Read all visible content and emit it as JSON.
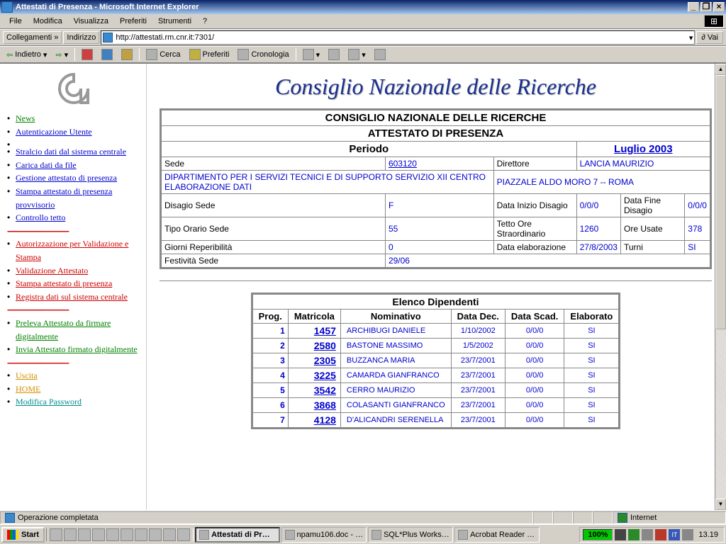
{
  "window": {
    "title": "Attestati di Presenza - Microsoft Internet Explorer",
    "menu": [
      "File",
      "Modifica",
      "Visualizza",
      "Preferiti",
      "Strumenti",
      "?"
    ],
    "links_label": "Collegamenti",
    "addr_label": "Indirizzo",
    "url": "http://attestati.rm.cnr.it:7301/",
    "go": "Vai",
    "back": "Indietro",
    "search": "Cerca",
    "fav": "Preferiti",
    "hist": "Cronologia"
  },
  "sidebar": {
    "items": [
      {
        "label": "News",
        "cls": "green"
      },
      {
        "label": "Autenticazione Utente",
        "cls": "blue"
      },
      {
        "spacer": true
      },
      {
        "label": "Stralcio dati dal sistema centrale",
        "cls": "blue"
      },
      {
        "label": "Carica dati da file",
        "cls": "blue"
      },
      {
        "label": "Gestione attestato di presenza",
        "cls": "blue"
      },
      {
        "label": "Stampa attestato di presenza provvisorio",
        "cls": "blue"
      },
      {
        "label": "Controllo tetto",
        "cls": "blue"
      },
      {
        "divider": true
      },
      {
        "label": "Autorizzazione per Validazione e Stampa",
        "cls": "red"
      },
      {
        "label": "Validazione Attestato",
        "cls": "red"
      },
      {
        "label": "Stampa attestato di presenza",
        "cls": "red"
      },
      {
        "label": "Registra dati sul sistema centrale",
        "cls": "red"
      },
      {
        "divider": true
      },
      {
        "label": "Preleva Attestato da firmare digitalmente",
        "cls": "green"
      },
      {
        "label": "Invia Attestato firmato digitalmente",
        "cls": "green"
      },
      {
        "divider": true
      },
      {
        "label": "Uscita",
        "cls": "orange"
      },
      {
        "label": "HOME",
        "cls": "orange"
      },
      {
        "label": "Modifica Password",
        "cls": "teal"
      }
    ]
  },
  "brand": "Consiglio Nazionale delle Ricerche",
  "header": {
    "l1": "CONSIGLIO NAZIONALE DELLE RICERCHE",
    "l2": "ATTESTATO DI PRESENZA",
    "periodo_lbl": "Periodo",
    "periodo_val": "Luglio 2003",
    "rows": [
      [
        "Sede",
        "603120",
        "Direttore",
        "LANCIA MAURIZIO"
      ],
      [
        "DIPARTIMENTO PER I SERVIZI TECNICI E DI SUPPORTO SERVIZIO XII CENTRO ELABORAZIONE DATI",
        "PIAZZALE ALDO MORO 7 -- ROMA"
      ],
      [
        "Disagio Sede",
        "F",
        "Data Inizio Disagio",
        "0/0/0",
        "Data Fine Disagio",
        "0/0/0"
      ],
      [
        "Tipo Orario Sede",
        "55",
        "Tetto Ore Straordinario",
        "1260",
        "Ore Usate",
        "378"
      ],
      [
        "Giorni Reperibilità",
        "0",
        "Data elaborazione",
        "27/8/2003",
        "Turni",
        "SI"
      ],
      [
        "Festività Sede",
        "29/06"
      ]
    ]
  },
  "emp": {
    "caption": "Elenco Dipendenti",
    "cols": [
      "Prog.",
      "Matricola",
      "Nominativo",
      "Data Dec.",
      "Data Scad.",
      "Elaborato"
    ],
    "rows": [
      [
        "1",
        "1457",
        "ARCHIBUGI DANIELE",
        "1/10/2002",
        "0/0/0",
        "SI"
      ],
      [
        "2",
        "2580",
        "BASTONE MASSIMO",
        "1/5/2002",
        "0/0/0",
        "SI"
      ],
      [
        "3",
        "2305",
        "BUZZANCA MARIA",
        "23/7/2001",
        "0/0/0",
        "SI"
      ],
      [
        "4",
        "3225",
        "CAMARDA GIANFRANCO",
        "23/7/2001",
        "0/0/0",
        "SI"
      ],
      [
        "5",
        "3542",
        "CERRO MAURIZIO",
        "23/7/2001",
        "0/0/0",
        "SI"
      ],
      [
        "6",
        "3868",
        "COLASANTI GIANFRANCO",
        "23/7/2001",
        "0/0/0",
        "SI"
      ],
      [
        "7",
        "4128",
        "D'ALICANDRI SERENELLA",
        "23/7/2001",
        "0/0/0",
        "SI"
      ]
    ]
  },
  "status": {
    "msg": "Operazione completata",
    "zone": "Internet"
  },
  "taskbar": {
    "start": "Start",
    "tasks": [
      {
        "label": "Attestati di Pr…",
        "active": true
      },
      {
        "label": "npamu106.doc - …"
      },
      {
        "label": "SQL*Plus Works…"
      },
      {
        "label": "Acrobat Reader …"
      }
    ],
    "pct": "100%",
    "clock": "13.19"
  }
}
